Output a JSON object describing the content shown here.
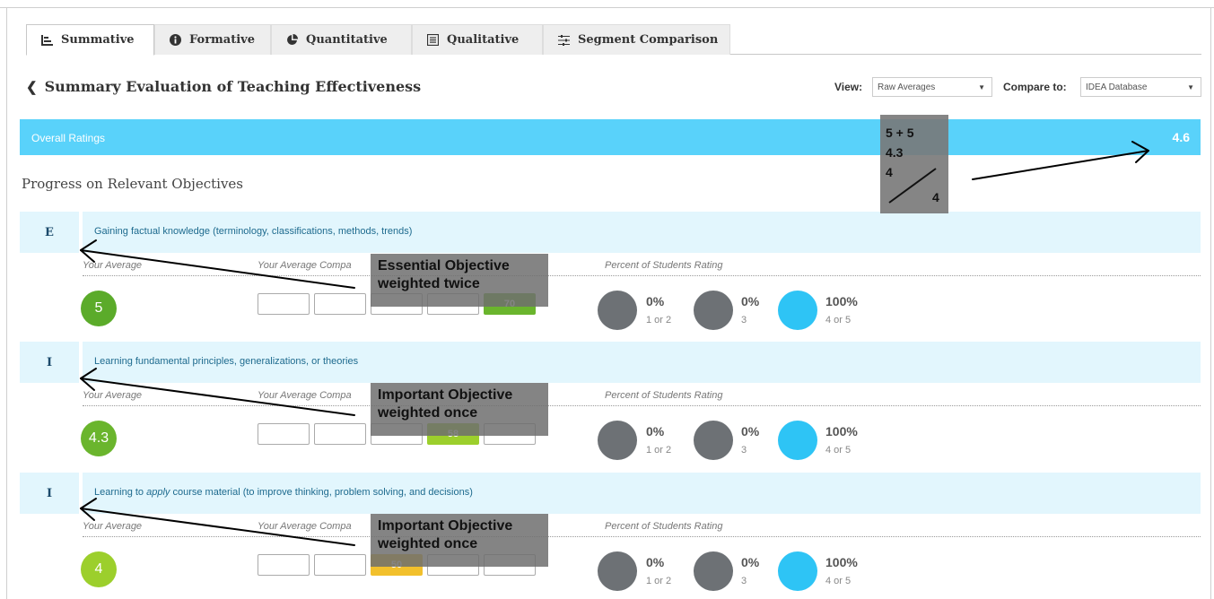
{
  "tabs": [
    {
      "label": "Summative",
      "icon": "bar-chart-icon",
      "active": true
    },
    {
      "label": "Formative",
      "icon": "info-icon",
      "active": false
    },
    {
      "label": "Quantitative",
      "icon": "pie-chart-icon",
      "active": false
    },
    {
      "label": "Qualitative",
      "icon": "list-icon",
      "active": false
    },
    {
      "label": "Segment Comparison",
      "icon": "sliders-icon",
      "active": false
    }
  ],
  "header": {
    "title": "Summary Evaluation of Teaching Effectiveness",
    "view_label": "View:",
    "view_value": "Raw Averages",
    "compare_label": "Compare to:",
    "compare_value": "IDEA Database"
  },
  "overall": {
    "label": "Overall Ratings",
    "score": "4.6"
  },
  "section_title": "Progress on Relevant Objectives",
  "column_labels": {
    "your_average": "Your Average",
    "your_average_compared": "Your Average Compa",
    "percent_rating": "Percent of Students Rating"
  },
  "objectives": [
    {
      "letter": "E",
      "text": "Gaining factual knowledge (terminology, classifications, methods, trends)",
      "average": "5",
      "compare_value": "70",
      "compare_index": 4,
      "compare_color": "#6ab52d",
      "pct_low": "0%",
      "pct_low_label": "1 or 2",
      "pct_mid": "0%",
      "pct_mid_label": "3",
      "pct_high": "100%",
      "pct_high_label": "4 or 5",
      "annotation": "Essential Objective weighted twice"
    },
    {
      "letter": "I",
      "text": "Learning fundamental principles, generalizations, or theories",
      "average": "4.3",
      "compare_value": "58",
      "compare_index": 3,
      "compare_color": "#9ccf2c",
      "pct_low": "0%",
      "pct_low_label": "1 or 2",
      "pct_mid": "0%",
      "pct_mid_label": "3",
      "pct_high": "100%",
      "pct_high_label": "4 or 5",
      "annotation": "Important Objective weighted once"
    },
    {
      "letter": "I",
      "text_pre": "Learning to ",
      "text_em": "apply",
      "text_post": " course material (to improve thinking, problem solving, and decisions)",
      "average": "4",
      "compare_value": "50",
      "compare_index": 2,
      "compare_color": "#f2c02c",
      "pct_low": "0%",
      "pct_low_label": "1 or 2",
      "pct_mid": "0%",
      "pct_mid_label": "3",
      "pct_high": "100%",
      "pct_high_label": "4 or 5",
      "annotation": "Important Objective weighted once"
    }
  ],
  "formula": {
    "line1": "5 + 5",
    "line2": "4.3",
    "line3": "4",
    "denominator": "4"
  },
  "colors": {
    "overall_bar": "#59d2fa",
    "objective_head": "#e2f6fd",
    "avg_5": "#5bab2a",
    "avg_43": "#6ab52d",
    "avg_4": "#9ccf2c",
    "pct_gray": "#6d7175",
    "pct_blue": "#2ec4f5"
  }
}
